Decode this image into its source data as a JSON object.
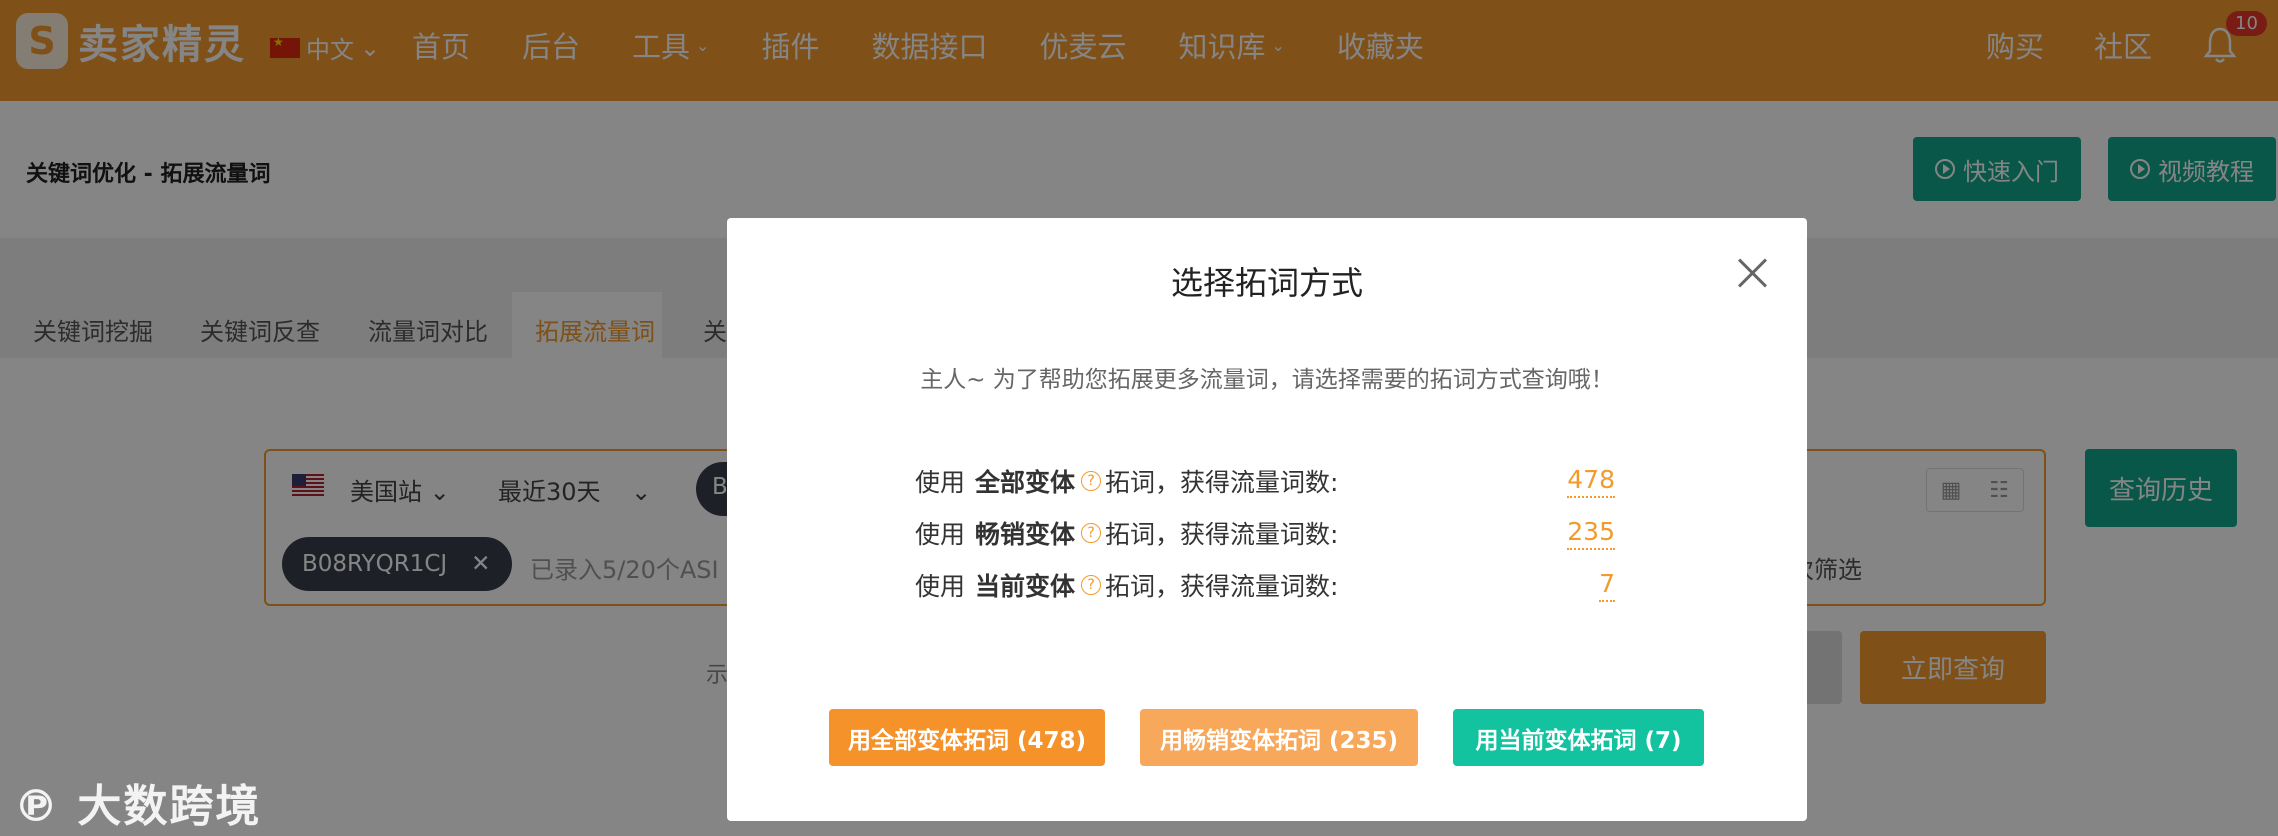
{
  "nav": {
    "brand": "卖家精灵",
    "language": "中文",
    "items": [
      "首页",
      "后台",
      "工具",
      "插件",
      "数据接口",
      "优麦云",
      "知识库",
      "收藏夹"
    ],
    "right_items": [
      "购买",
      "社区"
    ],
    "notification_count": "10"
  },
  "header": {
    "title": "关键词优化 - 拓展流量词",
    "quick_start": "快速入门",
    "video_tutorial": "视频教程"
  },
  "tabs": [
    "关键词挖掘",
    "关键词反查",
    "流量词对比",
    "拓展流量词",
    "关"
  ],
  "search": {
    "marketplace": "美国站",
    "period": "最近30天",
    "asin_chip": "B08RYQR1CJ",
    "chip2_initial": "B",
    "placeholder": "已录入5/20个ASI",
    "filter_hint": "次筛选",
    "history_button": "查询历史",
    "query_button": "立即查询",
    "hint_prefix": "示"
  },
  "watermark": "大数跨境",
  "modal": {
    "title": "选择拓词方式",
    "description": "主人~ 为了帮助您拓展更多流量词，请选择需要的拓词方式查询哦！",
    "options": [
      {
        "prefix": "使用",
        "name": "全部变体",
        "suffix": "拓词，获得流量词数:",
        "count": "478"
      },
      {
        "prefix": "使用",
        "name": "畅销变体",
        "suffix": "拓词，获得流量词数:",
        "count": "235"
      },
      {
        "prefix": "使用",
        "name": "当前变体",
        "suffix": "拓词，获得流量词数:",
        "count": "7"
      }
    ],
    "buttons": [
      {
        "label": "用全部变体拓词 (478)",
        "color": "#f5922a"
      },
      {
        "label": "用畅销变体拓词 (235)",
        "color": "#f8a85a"
      },
      {
        "label": "用当前变体拓词 (7)",
        "color": "#13c3a0"
      }
    ]
  },
  "colors": {
    "brand_orange": "#f39a2c",
    "teal": "#10a88a"
  }
}
